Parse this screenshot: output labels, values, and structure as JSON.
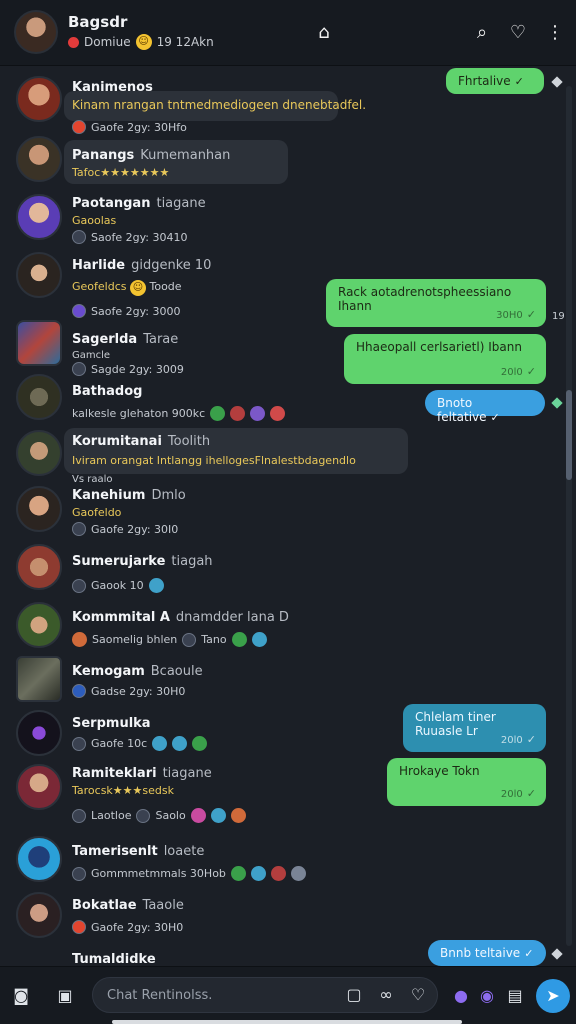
{
  "header": {
    "title": "Bagsdr",
    "subtitle": "Domiue",
    "subtitle_extra": "19 12Akn"
  },
  "messages": [
    {
      "name": "Kanimenos",
      "preview": "Kinam nrangan tntmedmediogeen dnenebtadfel.",
      "meta": "Gaofe 2gy: 30Hfo"
    },
    {
      "name": "Panangs",
      "name_extra": "Kumemanhan",
      "preview": "Tafoc★★★★★★★",
      "meta": ""
    },
    {
      "name": "Paotangan",
      "name_extra": "tiagane",
      "preview": "Gaoolas",
      "meta": "Saofe 2gy: 30410"
    },
    {
      "name": "Harlide",
      "name_extra": "gidgenke 10",
      "preview": "Geofeldcs",
      "preview_extra": "Toode",
      "meta": "Saofe 2gy: 3000"
    },
    {
      "name": "Sagerlda",
      "name_extra": "Tarae",
      "preview": "Gamcle",
      "meta": "Sagde 2gy: 3009"
    },
    {
      "name": "Bathadog",
      "preview": "",
      "meta": "kalkesle glehaton 900kc"
    },
    {
      "name": "Korumitanai",
      "name_extra": "Toolith",
      "preview": "Iviram orangat Intlangg ihellogesFlnalestbdagendlo",
      "meta": ""
    },
    {
      "name": "Kanehium",
      "name_extra": "Dmlo",
      "preview": "Gaofeldo",
      "meta": "Gaofe 2gy: 30I0",
      "pre_meta": "Vs raalo"
    },
    {
      "name": "Sumerujarke",
      "name_extra": "tiagah",
      "preview": "",
      "meta": "Gaook 10"
    },
    {
      "name": "Kommmital A",
      "name_extra": "dnamdder lana D",
      "preview": "",
      "meta": "Saomelig bhlen",
      "meta_extra": "Tano"
    },
    {
      "name": "Kemogam",
      "name_extra": "Bcaoule",
      "preview": "",
      "meta": "Gadse 2gy: 30H0"
    },
    {
      "name": "Serpmulka",
      "preview": "",
      "meta": "Gaofe 10c"
    },
    {
      "name": "Ramiteklari",
      "name_extra": "tiagane",
      "preview": "Tarocsk★★★sedsk",
      "meta": "Laotloe",
      "meta_extra": "Saolo"
    },
    {
      "name": "Tamerisenlt",
      "name_extra": "loaete",
      "preview": "",
      "meta": "Gommmetmmals 30Hob"
    },
    {
      "name": "Bokatlae",
      "name_extra": "Taaole",
      "preview": "",
      "meta": "Gaofe 2gy: 30H0"
    },
    {
      "name": "Tumaldidke",
      "preview": "",
      "meta": ""
    }
  ],
  "bubbles": [
    {
      "text": "Fhrtalive",
      "time": ""
    },
    {
      "text": "Rack aotadrenotspheessiano Ihann",
      "time": "30H0"
    },
    {
      "text": "Hhaeopall cerlsarietl) Ibann",
      "time": "20l0"
    },
    {
      "text": "Bnoto feltative",
      "time": ""
    },
    {
      "text": "Chlelam tiner Ruuasle Lr",
      "time": "20l0"
    },
    {
      "text": "Hrokaye Tokn",
      "time": "20l0"
    },
    {
      "text": "Bnnb teltaive",
      "time": ""
    }
  ],
  "tiny_right": "19",
  "composer": {
    "placeholder": "Chat Rentinolss."
  },
  "colors": {
    "accent": "#2f9ae4",
    "bubble_green": "#5fd36d",
    "bubble_blue": "#3a9fe0",
    "preview_gold": "#e9c85a"
  }
}
